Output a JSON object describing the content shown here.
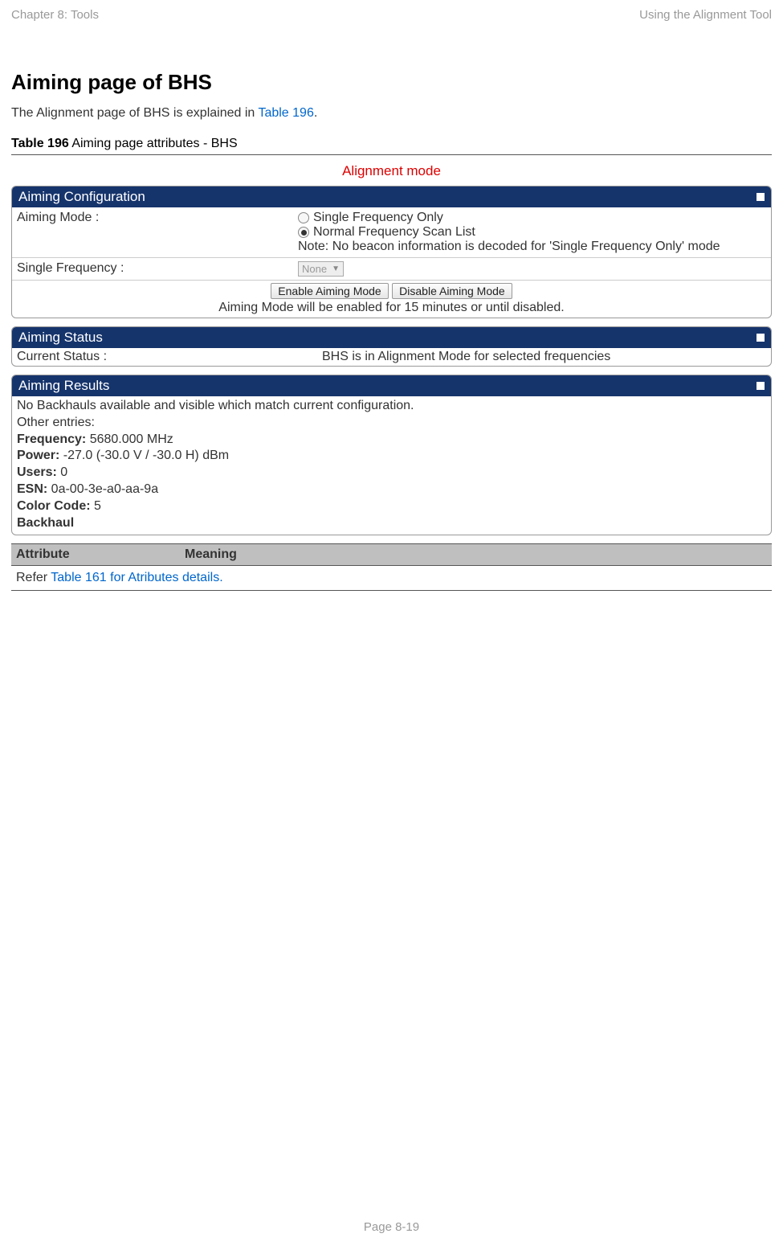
{
  "header": {
    "left": "Chapter 8:  Tools",
    "right": "Using the Alignment Tool"
  },
  "heading": "Aiming page of BHS",
  "intro": {
    "prefix": "The Alignment page of BHS is explained in ",
    "link": "Table 196",
    "suffix": "."
  },
  "table_caption": {
    "bold": "Table 196",
    "rest": " Aiming page attributes - BHS"
  },
  "alignment_label": "Alignment mode",
  "panels": {
    "config": {
      "title": "Aiming Configuration",
      "row1_label": "Aiming Mode :",
      "radio1": "Single Frequency Only",
      "radio2": "Normal Frequency Scan List",
      "note": "Note: No beacon information is decoded for 'Single Frequency Only' mode",
      "row2_label": "Single Frequency :",
      "select_value": "None",
      "btn_enable": "Enable Aiming Mode",
      "btn_disable": "Disable Aiming Mode",
      "btn_note": "Aiming Mode will be enabled for 15 minutes or until disabled."
    },
    "status": {
      "title": "Aiming Status",
      "label": "Current Status :",
      "value": "BHS is in Alignment Mode for selected frequencies"
    },
    "results": {
      "title": "Aiming Results",
      "line1": "No Backhauls available and visible which match current configuration.",
      "line2": "Other entries:",
      "freq_label": "Frequency:",
      "freq_val": " 5680.000 MHz",
      "power_label": "Power:",
      "power_val": " -27.0 (-30.0 V / -30.0 H) dBm",
      "users_label": "Users:",
      "users_val": " 0",
      "esn_label": "ESN:",
      "esn_val": " 0a-00-3e-a0-aa-9a",
      "cc_label": "Color Code:",
      "cc_val": " 5",
      "backhaul": "Backhaul"
    }
  },
  "attr_table": {
    "col1": "Attribute",
    "col2": "Meaning",
    "body_prefix": "Refer ",
    "body_link": "Table 161 for Atributes details."
  },
  "footer": "Page 8-19"
}
